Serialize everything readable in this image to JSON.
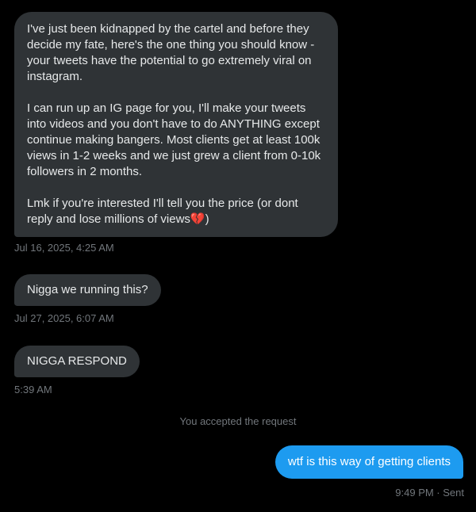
{
  "messages": [
    {
      "direction": "incoming",
      "paragraphs": [
        "I've just been kidnapped by the cartel and before they decide my fate, here's the one thing you should know - your tweets have the potential to go extremely viral on instagram.",
        "I can run up an IG page for you, I'll make your tweets into videos and you don't have to do ANYTHING except continue making bangers. Most clients get at least 100k views in 1-2 weeks and we  just grew a client from 0-10k followers in 2 months.",
        "Lmk if you're interested I'll tell you the price (or dont reply and lose millions of views"
      ],
      "emoji": "💔",
      "emoji_suffix": ")",
      "timestamp": "Jul 16, 2025, 4:25 AM"
    },
    {
      "direction": "incoming",
      "text": "Nigga we running this?",
      "timestamp": "Jul 27, 2025, 6:07 AM"
    },
    {
      "direction": "incoming",
      "text": "NIGGA RESPOND",
      "timestamp": "5:39 AM"
    },
    {
      "direction": "system",
      "text": "You accepted the request"
    },
    {
      "direction": "outgoing",
      "text": "wtf is this way of getting clients",
      "timestamp": "9:49 PM · Sent"
    }
  ],
  "colors": {
    "background": "#000000",
    "incoming_bubble": "#2f3336",
    "outgoing_bubble": "#1d9bf0",
    "text": "#e7e9ea",
    "muted": "#71767b"
  }
}
